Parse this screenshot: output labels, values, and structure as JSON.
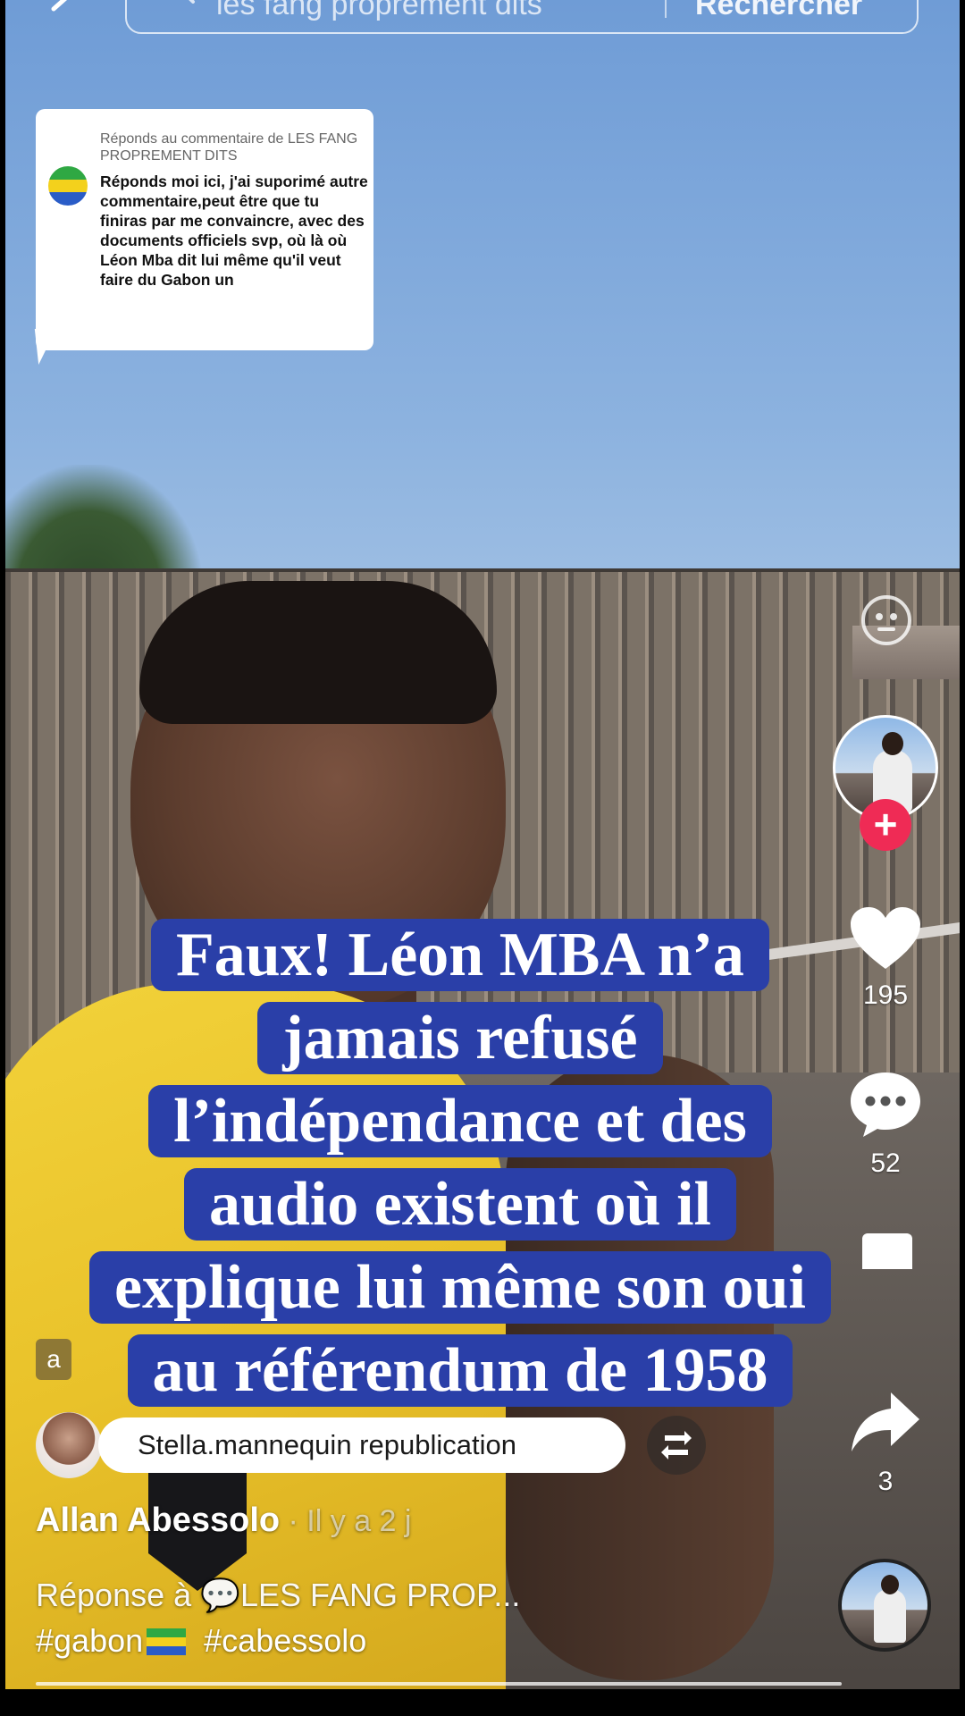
{
  "search": {
    "query": "les fang proprement dits",
    "button_label": "Rechercher"
  },
  "reply_card": {
    "header": "Réponds au commentaire de LES FANG PROPREMENT DITS",
    "body": "Réponds moi ici, j'ai suporimé autre commentaire,peut être que tu finiras par me convaincre, avec des documents officiels svp, où là où Léon Mba dit lui même qu'il veut faire du Gabon un"
  },
  "caption": {
    "lines": [
      "Faux! Léon MBA n’a",
      "jamais refusé",
      "l’indépendance et des",
      "audio existent où il",
      "explique lui même son oui",
      "au référendum de 1958"
    ]
  },
  "rail": {
    "likes": "195",
    "comments": "52",
    "shares": "3"
  },
  "stub_text": "a",
  "repost": {
    "label": "Stella.mannequin republication"
  },
  "author": {
    "name": "Allan Abessolo",
    "ago": " · Il y a 2 j"
  },
  "reply_line": "Réponse à 💬LES FANG PROP...",
  "tags": {
    "tag1": "#gabon",
    "tag2": "#cabessolo"
  },
  "progress": 0.98,
  "colors": {
    "caption_bg": "#2a3fa8",
    "follow": "#ef2b55",
    "gabon_green": "#2fa843",
    "gabon_yellow": "#f3d11c",
    "gabon_blue": "#2a5cc7"
  }
}
